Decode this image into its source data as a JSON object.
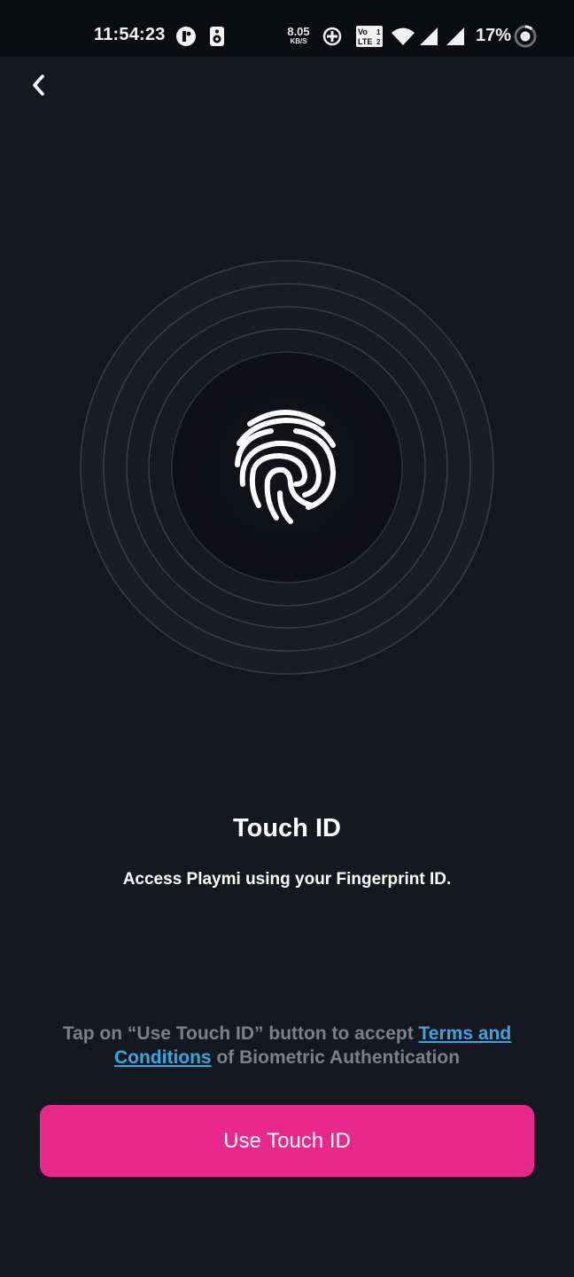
{
  "status_bar": {
    "time": "11:54:23",
    "net_speed_value": "8.05",
    "net_speed_unit": "KB/S",
    "volte_label_top": "Vo",
    "volte_label_bottom": "LTE",
    "sim1": "1",
    "sim2": "2",
    "battery_percent": "17%",
    "icons": [
      "profile-icon",
      "speaker-icon",
      "data-saver-icon",
      "volte-icon",
      "wifi-icon",
      "signal-icon",
      "signal-icon",
      "battery-icon"
    ]
  },
  "nav": {
    "back_icon": "chevron-left-icon"
  },
  "hero": {
    "icon": "fingerprint-icon",
    "ring_color": "#3a3d48"
  },
  "content": {
    "title": "Touch ID",
    "subtitle": "Access Playmi using your Fingerprint ID."
  },
  "terms": {
    "prefix": "Tap on “Use Touch ID” button to accept ",
    "link": "Terms and Conditions",
    "suffix": " of Biometric Authentication"
  },
  "cta": {
    "label": "Use Touch ID"
  },
  "colors": {
    "background": "#161821",
    "accent": "#e8288a",
    "link": "#36a8e0",
    "muted_text": "#7c7f8c"
  }
}
